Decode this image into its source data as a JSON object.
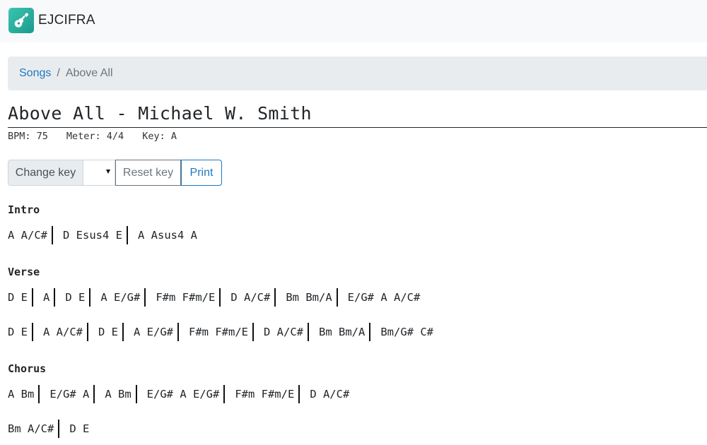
{
  "navbar": {
    "brand": "EJCIFRA"
  },
  "breadcrumb": {
    "parent": "Songs",
    "separator": "/",
    "current": "Above All"
  },
  "song": {
    "title": "Above All - Michael W. Smith",
    "bpm": "BPM: 75",
    "meter": "Meter: 4/4",
    "key": "Key: A"
  },
  "controls": {
    "change_key": "Change key",
    "reset_key": "Reset key",
    "print": "Print"
  },
  "sections": [
    {
      "name": "Intro",
      "lines": [
        [
          "A A/C#",
          "D Esus4 E",
          "A Asus4 A"
        ]
      ]
    },
    {
      "name": "Verse",
      "lines": [
        [
          "D E",
          "A",
          "D E",
          "A E/G#",
          "F#m F#m/E",
          "D A/C#",
          "Bm Bm/A",
          "E/G# A A/C#"
        ],
        [
          "D E",
          "A A/C#",
          "D E",
          "A E/G#",
          "F#m F#m/E",
          "D A/C#",
          "Bm Bm/A",
          "Bm/G# C#"
        ]
      ]
    },
    {
      "name": "Chorus",
      "lines": [
        [
          "A Bm",
          "E/G# A",
          "A Bm",
          "E/G# A E/G#",
          "F#m F#m/E",
          "D A/C#"
        ],
        [
          "Bm A/C#",
          "D E"
        ]
      ]
    }
  ]
}
